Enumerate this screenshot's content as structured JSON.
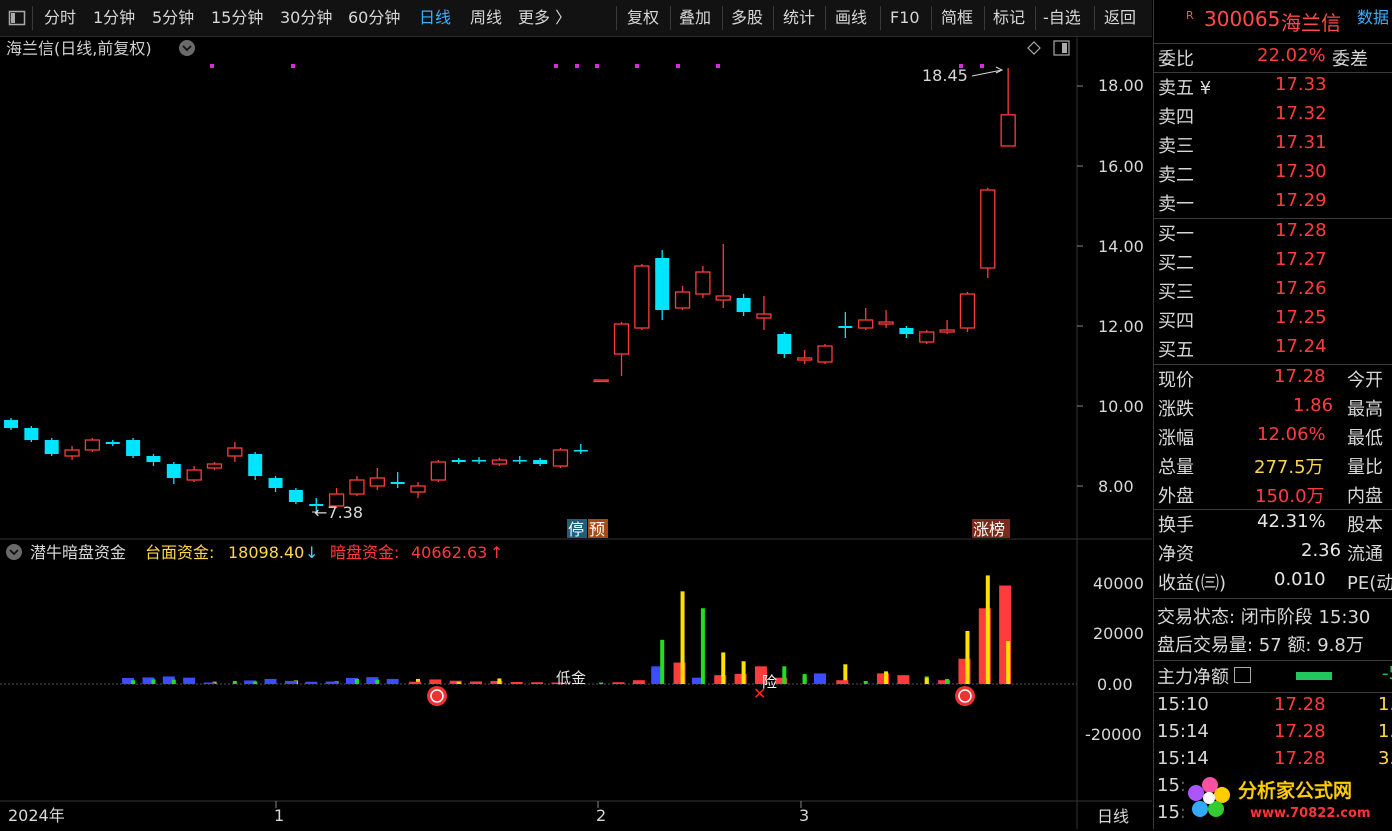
{
  "toolbar": {
    "periods": [
      "分时",
      "1分钟",
      "5分钟",
      "15分钟",
      "30分钟",
      "60分钟",
      "日线",
      "周线",
      "更多 〉"
    ],
    "active_period": "日线",
    "actions": [
      "复权",
      "叠加",
      "多股",
      "统计",
      "画线",
      "F10",
      "简框",
      "标记",
      "-自选",
      "返回"
    ]
  },
  "main_chart": {
    "title": "海兰信(日线,前复权)",
    "y_ticks": [
      "18.00",
      "16.00",
      "14.00",
      "12.00",
      "10.00",
      "8.00"
    ],
    "annotations": {
      "high": "18.45",
      "low": "7.38"
    },
    "markers": {
      "ting": "停",
      "yu": "预",
      "zhangbang": "涨榜"
    }
  },
  "indicator": {
    "name": "潜牛暗盘资金",
    "label1": "台面资金:",
    "value1": "18098.40",
    "arrow1": "↓",
    "label2": "暗盘资金:",
    "value2": "40662.63",
    "arrow2": "↑",
    "y_ticks": [
      "40000",
      "20000",
      "0.00",
      "-20000"
    ],
    "tag_low": "低金",
    "tag_risk": "险"
  },
  "time_axis": {
    "labels": [
      "2024年",
      "1",
      "2",
      "3"
    ],
    "period": "日线"
  },
  "quote": {
    "code": "300065",
    "name": "海兰信",
    "badge": "R",
    "data_tab": "数据",
    "weibi_label": "委比",
    "weibi_value": "22.02%",
    "weicha_label": "委差",
    "asks": [
      {
        "label": "卖五 ¥",
        "price": "17.33"
      },
      {
        "label": "卖四",
        "price": "17.32"
      },
      {
        "label": "卖三",
        "price": "17.31"
      },
      {
        "label": "卖二",
        "price": "17.30"
      },
      {
        "label": "卖一",
        "price": "17.29"
      }
    ],
    "bids": [
      {
        "label": "买一",
        "price": "17.28"
      },
      {
        "label": "买二",
        "price": "17.27"
      },
      {
        "label": "买三",
        "price": "17.26"
      },
      {
        "label": "买四",
        "price": "17.25"
      },
      {
        "label": "买五",
        "price": "17.24"
      }
    ],
    "stats": [
      {
        "label": "现价",
        "value": "17.28",
        "label2": "今开"
      },
      {
        "label": "涨跌",
        "value": "1.86",
        "label2": "最高"
      },
      {
        "label": "涨幅",
        "value": "12.06%",
        "label2": "最低"
      },
      {
        "label": "总量",
        "value": "277.5万",
        "label2": "量比"
      },
      {
        "label": "外盘",
        "value": "150.0万",
        "label2": "内盘"
      }
    ],
    "stats2": [
      {
        "label": "换手",
        "value": "42.31%",
        "label2": "股本"
      },
      {
        "label": "净资",
        "value": "2.36",
        "label2": "流通"
      },
      {
        "label": "收益(㈢)",
        "value": "0.010",
        "label2": "PE(动)"
      }
    ],
    "trade_status": "交易状态: 闭市阶段 15:30",
    "after_hours": "盘后交易量: 57  额: 9.8万",
    "main_net_label": "主力净额",
    "main_net_value": "-5",
    "ticks": [
      {
        "time": "15:10",
        "price": "17.28",
        "vol": "1."
      },
      {
        "time": "15:14",
        "price": "17.28",
        "vol": "1."
      },
      {
        "time": "15:14",
        "price": "17.28",
        "vol": "3."
      },
      {
        "time": "15:",
        "price": "",
        "vol": ""
      },
      {
        "time": "15:",
        "price": "",
        "vol": ""
      }
    ]
  },
  "watermark": {
    "text": "分析家公式网",
    "url": "www.70822.com"
  },
  "colors": {
    "up": "#ff3b3b",
    "down": "#00e5ff",
    "blue_bar": "#3b4dff",
    "yellow": "#ffe000",
    "green": "#22dd22",
    "magenta": "#d82cd8"
  },
  "chart_data": {
    "type": "candlestick",
    "title": "海兰信(日线,前复权)",
    "ylim": [
      6.6,
      19.6
    ],
    "x_labels": [
      "2024年",
      "1",
      "2",
      "3"
    ],
    "candles": [
      {
        "o": 9.65,
        "c": 9.45,
        "h": 9.7,
        "l": 9.4
      },
      {
        "o": 9.45,
        "c": 9.15,
        "h": 9.5,
        "l": 9.1
      },
      {
        "o": 9.15,
        "c": 8.8,
        "h": 9.2,
        "l": 8.75
      },
      {
        "o": 8.75,
        "c": 8.9,
        "h": 9.0,
        "l": 8.65
      },
      {
        "o": 8.9,
        "c": 9.15,
        "h": 9.2,
        "l": 8.85
      },
      {
        "o": 9.1,
        "c": 9.05,
        "h": 9.15,
        "l": 9.0
      },
      {
        "o": 9.15,
        "c": 8.75,
        "h": 9.2,
        "l": 8.7
      },
      {
        "o": 8.75,
        "c": 8.6,
        "h": 8.8,
        "l": 8.5
      },
      {
        "o": 8.55,
        "c": 8.2,
        "h": 8.6,
        "l": 8.05
      },
      {
        "o": 8.15,
        "c": 8.4,
        "h": 8.5,
        "l": 8.1
      },
      {
        "o": 8.45,
        "c": 8.55,
        "h": 8.6,
        "l": 8.4
      },
      {
        "o": 8.75,
        "c": 8.95,
        "h": 9.1,
        "l": 8.6
      },
      {
        "o": 8.8,
        "c": 8.25,
        "h": 8.85,
        "l": 8.15
      },
      {
        "o": 8.2,
        "c": 7.95,
        "h": 8.25,
        "l": 7.85
      },
      {
        "o": 7.9,
        "c": 7.6,
        "h": 7.95,
        "l": 7.55
      },
      {
        "o": 7.55,
        "c": 7.5,
        "h": 7.7,
        "l": 7.38
      },
      {
        "o": 7.5,
        "c": 7.8,
        "h": 7.95,
        "l": 7.45
      },
      {
        "o": 7.8,
        "c": 8.15,
        "h": 8.25,
        "l": 7.75
      },
      {
        "o": 8.0,
        "c": 8.2,
        "h": 8.45,
        "l": 7.9
      },
      {
        "o": 8.1,
        "c": 8.05,
        "h": 8.35,
        "l": 7.95
      },
      {
        "o": 7.85,
        "c": 8.0,
        "h": 8.1,
        "l": 7.7
      },
      {
        "o": 8.15,
        "c": 8.6,
        "h": 8.65,
        "l": 8.1
      },
      {
        "o": 8.65,
        "c": 8.6,
        "h": 8.7,
        "l": 8.55
      },
      {
        "o": 8.65,
        "c": 8.62,
        "h": 8.72,
        "l": 8.55
      },
      {
        "o": 8.55,
        "c": 8.65,
        "h": 8.7,
        "l": 8.5
      },
      {
        "o": 8.65,
        "c": 8.62,
        "h": 8.75,
        "l": 8.55
      },
      {
        "o": 8.65,
        "c": 8.55,
        "h": 8.7,
        "l": 8.5
      },
      {
        "o": 8.5,
        "c": 8.9,
        "h": 8.95,
        "l": 8.45
      },
      {
        "o": 8.9,
        "c": 8.88,
        "h": 9.05,
        "l": 8.8
      },
      {
        "o": 10.65,
        "c": 10.65,
        "h": 10.65,
        "l": 10.65
      },
      {
        "o": 11.3,
        "c": 12.05,
        "h": 12.1,
        "l": 10.75
      },
      {
        "o": 11.95,
        "c": 13.5,
        "h": 13.55,
        "l": 11.9
      },
      {
        "o": 13.7,
        "c": 12.4,
        "h": 13.9,
        "l": 12.15
      },
      {
        "o": 12.45,
        "c": 12.85,
        "h": 13.0,
        "l": 12.4
      },
      {
        "o": 12.8,
        "c": 13.35,
        "h": 13.5,
        "l": 12.7
      },
      {
        "o": 12.65,
        "c": 12.75,
        "h": 14.05,
        "l": 12.45
      },
      {
        "o": 12.7,
        "c": 12.35,
        "h": 12.8,
        "l": 12.25
      },
      {
        "o": 12.2,
        "c": 12.3,
        "h": 12.75,
        "l": 11.9
      },
      {
        "o": 11.8,
        "c": 11.3,
        "h": 11.85,
        "l": 11.2
      },
      {
        "o": 11.15,
        "c": 11.2,
        "h": 11.4,
        "l": 11.05
      },
      {
        "o": 11.1,
        "c": 11.5,
        "h": 11.55,
        "l": 11.05
      },
      {
        "o": 12.0,
        "c": 11.95,
        "h": 12.35,
        "l": 11.7
      },
      {
        "o": 11.95,
        "c": 12.15,
        "h": 12.45,
        "l": 11.9
      },
      {
        "o": 12.05,
        "c": 12.1,
        "h": 12.4,
        "l": 11.95
      },
      {
        "o": 11.95,
        "c": 11.8,
        "h": 12.0,
        "l": 11.7
      },
      {
        "o": 11.6,
        "c": 11.85,
        "h": 11.9,
        "l": 11.55
      },
      {
        "o": 11.85,
        "c": 11.9,
        "h": 12.15,
        "l": 11.8
      },
      {
        "o": 11.95,
        "c": 12.8,
        "h": 12.85,
        "l": 11.85
      },
      {
        "o": 13.45,
        "c": 15.4,
        "h": 15.45,
        "l": 13.2
      },
      {
        "o": 16.5,
        "c": 17.28,
        "h": 18.45,
        "l": 16.5
      }
    ],
    "indicator_bars": [
      {
        "pos": 6,
        "color": "blue",
        "value": 2400
      },
      {
        "pos": 6,
        "color": "green",
        "value": 1500
      },
      {
        "pos": 7,
        "color": "blue",
        "value": 2600
      },
      {
        "pos": 7,
        "color": "green",
        "value": 1800
      },
      {
        "pos": 8,
        "color": "blue",
        "value": 3000
      },
      {
        "pos": 8,
        "color": "green",
        "value": 1700
      },
      {
        "pos": 9,
        "color": "blue",
        "value": 2500
      },
      {
        "pos": 10,
        "color": "yellow",
        "value": 900
      },
      {
        "pos": 10,
        "color": "blue",
        "value": 600
      },
      {
        "pos": 11,
        "color": "green",
        "value": 1200
      },
      {
        "pos": 12,
        "color": "blue",
        "value": 1400
      },
      {
        "pos": 12,
        "color": "green",
        "value": 1000
      },
      {
        "pos": 13,
        "color": "blue",
        "value": 2000
      },
      {
        "pos": 14,
        "color": "yellow",
        "value": 1400
      },
      {
        "pos": 14,
        "color": "blue",
        "value": 1200
      },
      {
        "pos": 15,
        "color": "blue",
        "value": 900
      },
      {
        "pos": 16,
        "color": "green",
        "value": 1200
      },
      {
        "pos": 16,
        "color": "blue",
        "value": 1000
      },
      {
        "pos": 17,
        "color": "blue",
        "value": 2400
      },
      {
        "pos": 17,
        "color": "green",
        "value": 2000
      },
      {
        "pos": 18,
        "color": "blue",
        "value": 2700
      },
      {
        "pos": 18,
        "color": "green",
        "value": 1700
      },
      {
        "pos": 19,
        "color": "blue",
        "value": 2000
      },
      {
        "pos": 20,
        "color": "yellow",
        "value": 2000
      },
      {
        "pos": 20,
        "color": "red",
        "value": 900
      },
      {
        "pos": 21,
        "color": "red",
        "value": 1800
      },
      {
        "pos": 22,
        "color": "red",
        "value": 1300
      },
      {
        "pos": 22,
        "color": "yellow",
        "value": 900
      },
      {
        "pos": 23,
        "color": "red",
        "value": 1000
      },
      {
        "pos": 24,
        "color": "red",
        "value": 1200
      },
      {
        "pos": 24,
        "color": "yellow",
        "value": 2200
      },
      {
        "pos": 25,
        "color": "red",
        "value": 800
      },
      {
        "pos": 26,
        "color": "red",
        "value": 700
      },
      {
        "pos": 27,
        "color": "red",
        "value": 600
      },
      {
        "pos": 28,
        "color": "red",
        "value": 400
      },
      {
        "pos": 29,
        "color": "green",
        "value": 600
      },
      {
        "pos": 30,
        "color": "red",
        "value": 700
      },
      {
        "pos": 31,
        "color": "red",
        "value": 1500
      },
      {
        "pos": 32,
        "color": "blue",
        "value": 7000
      },
      {
        "pos": 32,
        "color": "green",
        "value": 17500
      },
      {
        "pos": 33,
        "color": "red",
        "value": 8500
      },
      {
        "pos": 33,
        "color": "yellow",
        "value": 36700
      },
      {
        "pos": 34,
        "color": "blue",
        "value": 2500
      },
      {
        "pos": 34,
        "color": "green",
        "value": 30000
      },
      {
        "pos": 35,
        "color": "red",
        "value": 3500
      },
      {
        "pos": 35,
        "color": "yellow",
        "value": 12500
      },
      {
        "pos": 36,
        "color": "red",
        "value": 4000
      },
      {
        "pos": 36,
        "color": "yellow",
        "value": 9000
      },
      {
        "pos": 37,
        "color": "red",
        "value": 7000
      },
      {
        "pos": 38,
        "color": "red",
        "value": 2500
      },
      {
        "pos": 38,
        "color": "green",
        "value": 7000
      },
      {
        "pos": 39,
        "color": "yellow",
        "value": 3000
      },
      {
        "pos": 39,
        "color": "green",
        "value": 4000
      },
      {
        "pos": 40,
        "color": "blue",
        "value": 4200
      },
      {
        "pos": 41,
        "color": "yellow",
        "value": 7800
      },
      {
        "pos": 41,
        "color": "red",
        "value": 1500
      },
      {
        "pos": 42,
        "color": "green",
        "value": 1200
      },
      {
        "pos": 43,
        "color": "red",
        "value": 4200
      },
      {
        "pos": 43,
        "color": "yellow",
        "value": 5000
      },
      {
        "pos": 44,
        "color": "red",
        "value": 3500
      },
      {
        "pos": 45,
        "color": "green",
        "value": 3000
      },
      {
        "pos": 45,
        "color": "yellow",
        "value": 2500
      },
      {
        "pos": 46,
        "color": "red",
        "value": 1500
      },
      {
        "pos": 46,
        "color": "green",
        "value": 2000
      },
      {
        "pos": 47,
        "color": "red",
        "value": 10000
      },
      {
        "pos": 47,
        "color": "yellow",
        "value": 21000
      },
      {
        "pos": 48,
        "color": "red",
        "value": 30000
      },
      {
        "pos": 48,
        "color": "yellow",
        "value": 43000
      },
      {
        "pos": 49,
        "color": "red",
        "value": 39000
      },
      {
        "pos": 49,
        "color": "yellow",
        "value": 17000
      }
    ],
    "indicator_ylim": [
      -40000,
      46000
    ]
  }
}
